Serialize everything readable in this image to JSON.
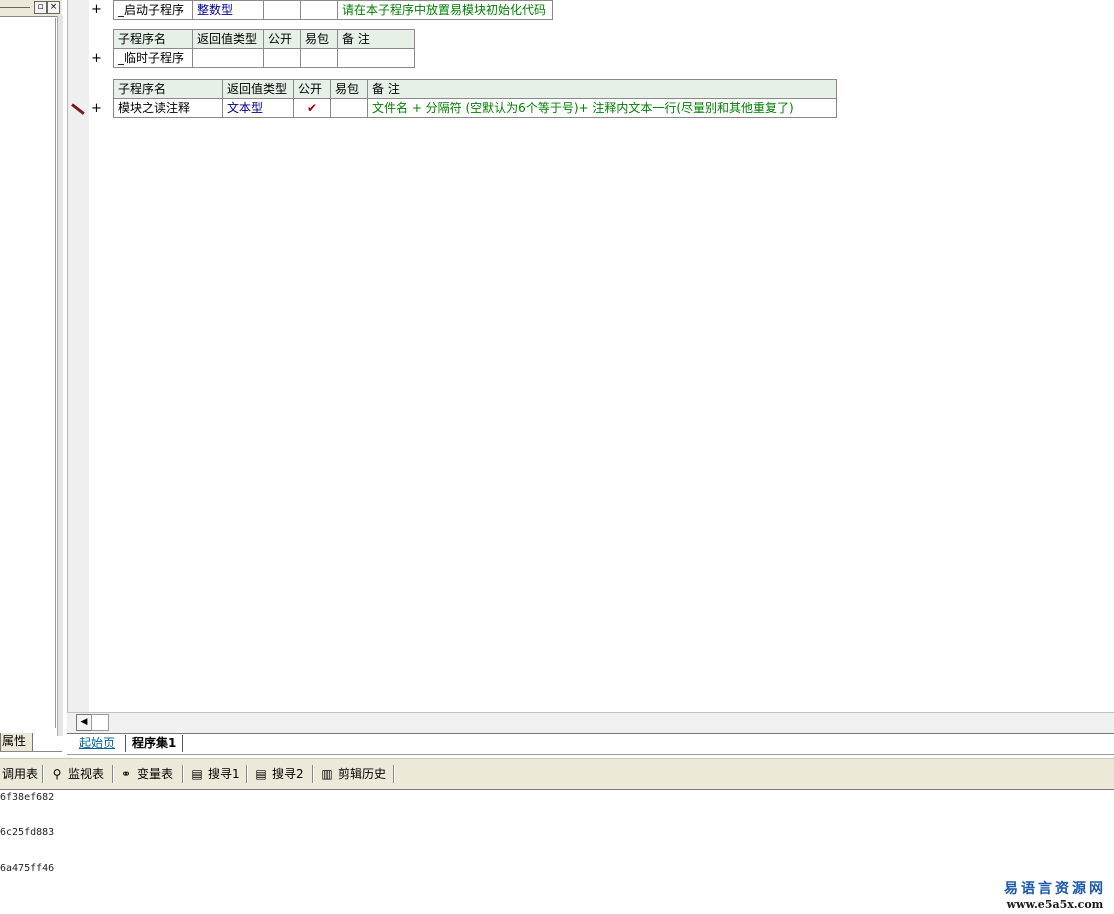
{
  "left_panel": {
    "tab_label": "属性"
  },
  "table1": {
    "row": {
      "name": "_启动子程序",
      "return_type": "整数型",
      "public": "",
      "easy_pack": "",
      "note": "请在本子程序中放置易模块初始化代码"
    }
  },
  "table2": {
    "headers": [
      "子程序名",
      "返回值类型",
      "公开",
      "易包",
      "备 注"
    ],
    "row": {
      "name": "_临时子程序",
      "return_type": "",
      "public": "",
      "easy_pack": "",
      "note": ""
    }
  },
  "table3": {
    "headers": [
      "子程序名",
      "返回值类型",
      "公开",
      "易包",
      "备 注"
    ],
    "row": {
      "name": "模块之读注释",
      "return_type": "文本型",
      "public": "✔",
      "easy_pack": "",
      "note": "文件名  +  分隔符 (空默认为6个等于号)+ 注释内文本一行(尽量别和其他重复了)"
    }
  },
  "gutter": {
    "plus_symbol": "+"
  },
  "tabs": {
    "home": "起始页",
    "program_set": "程序集1"
  },
  "toolbar": {
    "call_table": "调用表",
    "watch_table": "监视表",
    "variable_table": "变量表",
    "search1": "搜寻1",
    "search2": "搜寻2",
    "clip_history": "剪辑历史"
  },
  "output": {
    "lines": [
      "6f38ef682",
      "6c25fd883",
      "6a475ff46"
    ]
  },
  "watermark": {
    "title": "易语言资源网",
    "url": "www.e5a5x.com"
  }
}
